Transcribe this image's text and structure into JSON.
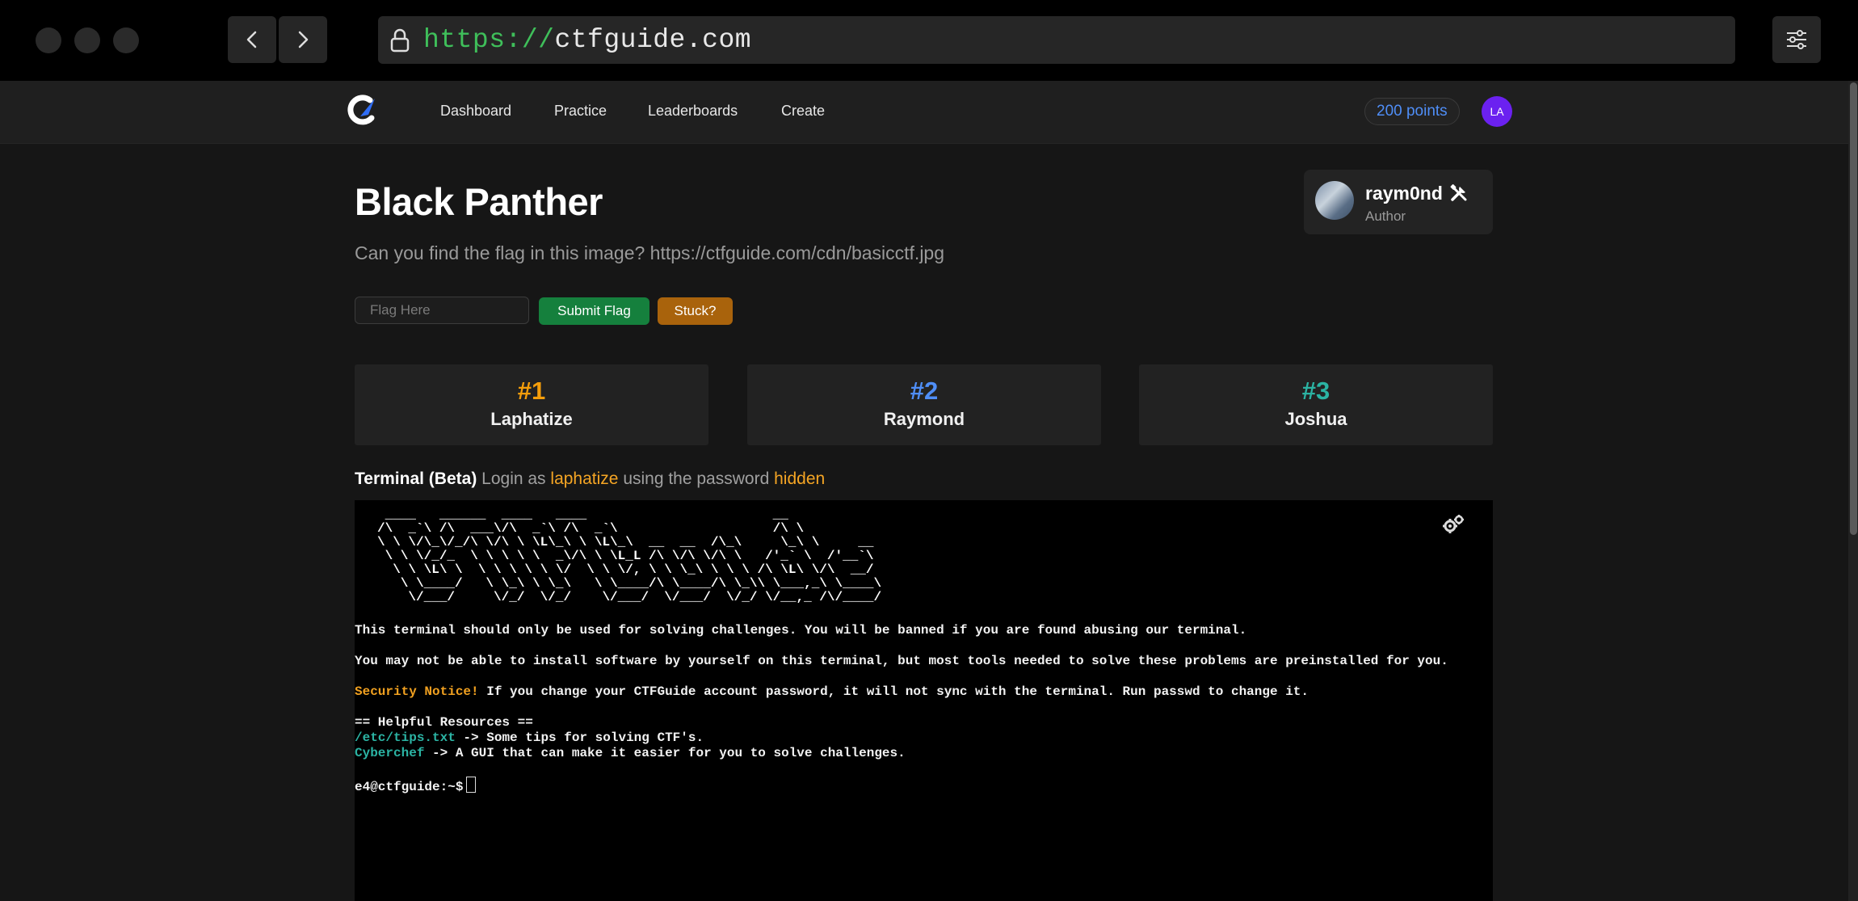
{
  "browser": {
    "url_protocol": "https://",
    "url_host": "ctfguide.com"
  },
  "nav": {
    "links": [
      "Dashboard",
      "Practice",
      "Leaderboards",
      "Create"
    ],
    "points": "200 points",
    "avatar_initials": "LA"
  },
  "challenge": {
    "title": "Black Panther",
    "description": "Can you find the flag in this image? https://ctfguide.com/cdn/basicctf.jpg",
    "flag_placeholder": "Flag Here",
    "submit_label": "Submit Flag",
    "stuck_label": "Stuck?"
  },
  "author": {
    "name": "raym0nd",
    "role": "Author"
  },
  "leaderboard": [
    {
      "rank": "#1",
      "name": "Laphatize",
      "color": "#f59e0b"
    },
    {
      "rank": "#2",
      "name": "Raymond",
      "color": "#4f8ef7"
    },
    {
      "rank": "#3",
      "name": "Joshua",
      "color": "#2bb3a3"
    }
  ],
  "terminal_header": {
    "label": "Terminal (Beta)",
    "login_as": "Login as",
    "username": "laphatize",
    "using": "using the password",
    "password": "hidden"
  },
  "terminal": {
    "warning1": "This terminal should only be used for solving challenges. You will be banned if you are found abusing our terminal.",
    "warning2": "You may not be able to install software by yourself on this terminal, but most tools needed to solve these problems are preinstalled for you.",
    "security_label": "Security Notice!",
    "security_text": " If you change your CTFGuide account password, it will not sync with the terminal. Run passwd to change it.",
    "resources_heading": "== Helpful Resources ==",
    "res1_link": "/etc/tips.txt",
    "res1_text": " -> Some tips for solving CTF's.",
    "res2_link": "Cyberchef",
    "res2_text": " -> A GUI that can make it easier for you to solve challenges.",
    "prompt": "e4@ctfguide:~$"
  },
  "colors": {
    "accent_blue": "#4f8ef7",
    "accent_orange": "#f59e0b",
    "accent_teal": "#2bb3a3",
    "submit_green": "#15803d",
    "stuck_orange": "#a9630c"
  }
}
